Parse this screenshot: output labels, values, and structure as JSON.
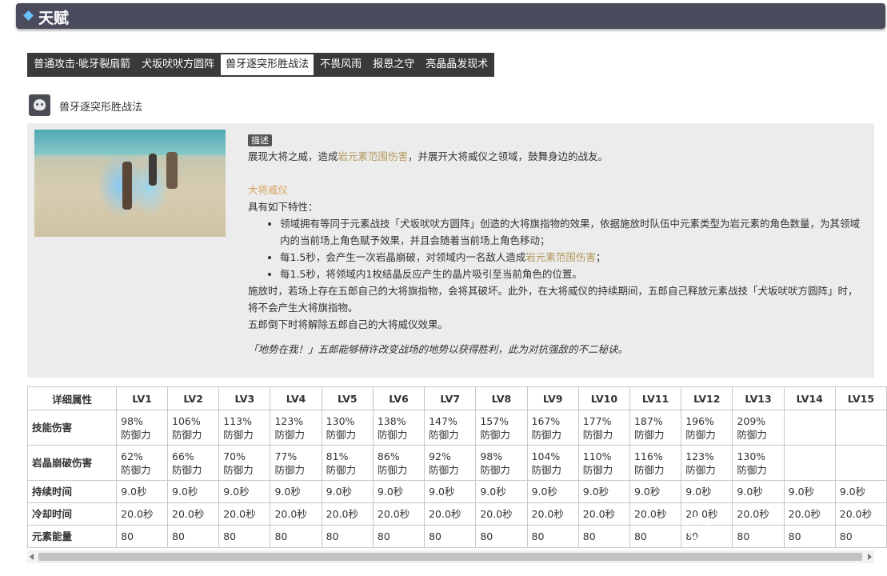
{
  "header": {
    "title": "天赋",
    "accent": "#6ec1ff",
    "bg": "#4a4c5e"
  },
  "tabs": [
    {
      "label": "普通攻击·呲牙裂扇箭",
      "active": false
    },
    {
      "label": "犬坂吠吠方圆阵",
      "active": false
    },
    {
      "label": "兽牙逐突形胜战法",
      "active": true
    },
    {
      "label": "不畏风雨",
      "active": false
    },
    {
      "label": "报恩之守",
      "active": false
    },
    {
      "label": "亮晶晶发现术",
      "active": false
    }
  ],
  "skill": {
    "name": "兽牙逐突形胜战法",
    "icon": "dog-face-icon",
    "badge": "描述",
    "desc_pre": "展现大将之威，造成",
    "desc_hl": "岩元素范围伤害",
    "desc_post": "，并展开大将威仪之领域，鼓舞身边的战友。",
    "subtitle": "大将威仪",
    "traits_intro": "具有如下特性：",
    "trait1": "领域拥有等同于元素战技「犬坂吠吠方圆阵」创造的大将旗指物的效果，依据施放时队伍中元素类型为岩元素的角色数量，为其领域内的当前场上角色赋予效果，并且会随着当前场上角色移动；",
    "trait2_pre": "每1.5秒，会产生一次岩晶崩破，对领域内一名敌人造成",
    "trait2_hl": "岩元素范围伤害",
    "trait2_post": "；",
    "trait3": "每1.5秒，将领域内1枚结晶反应产生的晶片吸引至当前角色的位置。",
    "para1": "施放时，若场上存在五郎自己的大将旗指物，会将其破坏。此外，在大将威仪的持续期间，五郎自己释放元素战技「犬坂吠吠方圆阵」时，将不会产生大将旗指物。",
    "para2": "五郎倒下时将解除五郎自己的大将威仪效果。",
    "quote": "「地势在我！」五郎能够稍许改变战场的地势以获得胜利，此为对抗强敌的不二秘诀。"
  },
  "table": {
    "header_label": "详细属性",
    "levels": [
      "LV1",
      "LV2",
      "LV3",
      "LV4",
      "LV5",
      "LV6",
      "LV7",
      "LV8",
      "LV9",
      "LV10",
      "LV11",
      "LV12",
      "LV13",
      "LV14",
      "LV15"
    ],
    "rows": [
      {
        "label": "技能伤害",
        "values": [
          "98%\n防御力",
          "106%\n防御力",
          "113%\n防御力",
          "123%\n防御力",
          "130%\n防御力",
          "138%\n防御力",
          "147%\n防御力",
          "157%\n防御力",
          "167%\n防御力",
          "177%\n防御力",
          "187%\n防御力",
          "196%\n防御力",
          "209%\n防御力",
          "",
          ""
        ]
      },
      {
        "label": "岩晶崩破伤害",
        "values": [
          "62%\n防御力",
          "66%\n防御力",
          "70%\n防御力",
          "77%\n防御力",
          "81%\n防御力",
          "86%\n防御力",
          "92%\n防御力",
          "98%\n防御力",
          "104%\n防御力",
          "110%\n防御力",
          "116%\n防御力",
          "123%\n防御力",
          "130%\n防御力",
          "",
          ""
        ]
      },
      {
        "label": "持续时间",
        "values": [
          "9.0秒",
          "9.0秒",
          "9.0秒",
          "9.0秒",
          "9.0秒",
          "9.0秒",
          "9.0秒",
          "9.0秒",
          "9.0秒",
          "9.0秒",
          "9.0秒",
          "9.0秒",
          "9.0秒",
          "9.0秒",
          "9.0秒"
        ]
      },
      {
        "label": "冷却时间",
        "values": [
          "20.0秒",
          "20.0秒",
          "20.0秒",
          "20.0秒",
          "20.0秒",
          "20.0秒",
          "20.0秒",
          "20.0秒",
          "20.0秒",
          "20.0秒",
          "20.0秒",
          "20.0秒",
          "20.0秒",
          "20.0秒",
          "20.0秒"
        ]
      },
      {
        "label": "元素能量",
        "values": [
          "80",
          "80",
          "80",
          "80",
          "80",
          "80",
          "80",
          "80",
          "80",
          "80",
          "80",
          "80",
          "80",
          "80",
          "80"
        ]
      }
    ]
  }
}
